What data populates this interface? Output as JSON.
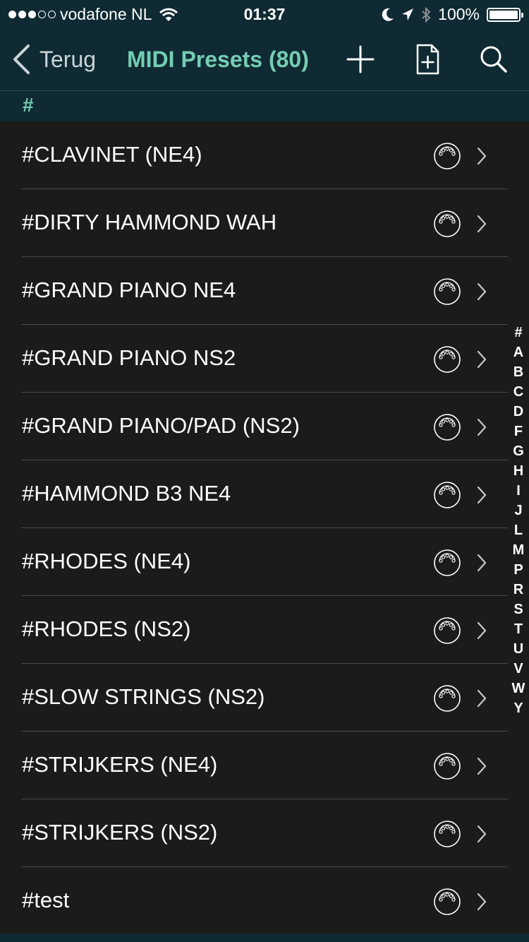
{
  "status_bar": {
    "carrier": "vodafone NL",
    "time": "01:37",
    "battery": "100%"
  },
  "nav": {
    "back_label": "Terug",
    "title": "MIDI Presets (80)"
  },
  "section": {
    "header": "#"
  },
  "presets": [
    "#CLAVINET (NE4)",
    "#DIRTY HAMMOND WAH",
    "#GRAND PIANO NE4",
    "#GRAND PIANO NS2",
    "#GRAND PIANO/PAD (NS2)",
    "#HAMMOND B3 NE4",
    "#RHODES (NE4)",
    "#RHODES (NS2)",
    "#SLOW STRINGS (NS2)",
    "#STRIJKERS (NE4)",
    "#STRIJKERS (NS2)",
    "#test"
  ],
  "index_letters": [
    "#",
    "A",
    "B",
    "C",
    "D",
    "F",
    "G",
    "H",
    "I",
    "J",
    "L",
    "M",
    "P",
    "R",
    "S",
    "T",
    "U",
    "V",
    "W",
    "Y"
  ],
  "colors": {
    "accent": "#74cdb3",
    "navbar": "#0f2a33",
    "background": "#1c1b1a"
  },
  "icons": {
    "row_icon": "midi-connector-icon",
    "row_disclosure": "chevron-right-icon",
    "nav_add": "plus-icon",
    "nav_new_document": "document-add-icon",
    "nav_search": "search-icon"
  }
}
